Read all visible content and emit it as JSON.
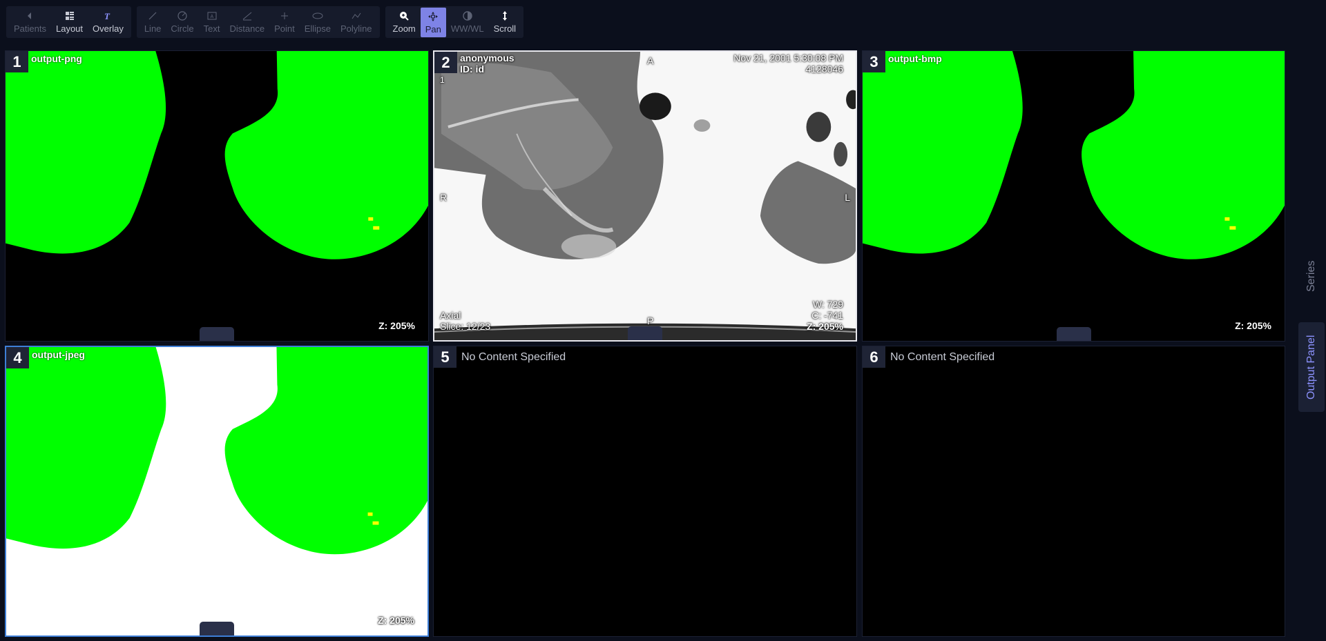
{
  "toolbar": {
    "group1": [
      {
        "label": "Patients",
        "icon": "back-arrow-icon",
        "disabled": true
      },
      {
        "label": "Layout",
        "icon": "layout-grid-icon",
        "disabled": false
      },
      {
        "label": "Overlay",
        "icon": "text-overlay-icon",
        "disabled": false
      }
    ],
    "group2": [
      {
        "label": "Line",
        "icon": "line-icon"
      },
      {
        "label": "Circle",
        "icon": "circle-icon"
      },
      {
        "label": "Text",
        "icon": "text-icon"
      },
      {
        "label": "Distance",
        "icon": "distance-icon"
      },
      {
        "label": "Point",
        "icon": "point-icon"
      },
      {
        "label": "Ellipse",
        "icon": "ellipse-icon"
      },
      {
        "label": "Polyline",
        "icon": "polyline-icon"
      }
    ],
    "group3": [
      {
        "label": "Zoom",
        "icon": "zoom-icon"
      },
      {
        "label": "Pan",
        "icon": "pan-icon",
        "active": true
      },
      {
        "label": "WW/WL",
        "icon": "window-level-icon",
        "disabled": true
      },
      {
        "label": "Scroll",
        "icon": "scroll-icon"
      }
    ]
  },
  "viewports": {
    "vp1": {
      "number": "1",
      "title": "output-png",
      "zoom": "Z: 205%"
    },
    "vp2": {
      "number": "2",
      "patient_name": "anonymous",
      "patient_id": "ID: id",
      "series_index": "1",
      "study_date": "Nov 21, 2001 5:30:08 PM",
      "study_number": "4128046",
      "orient_top": "A",
      "orient_bottom": "P",
      "orient_left": "R",
      "orient_right": "L",
      "plane": "Axial",
      "slice": "Slice: 12/23",
      "window_width": "W: 729",
      "window_center": "C: -741",
      "zoom": "Z: 205%"
    },
    "vp3": {
      "number": "3",
      "title": "output-bmp",
      "zoom": "Z: 205%"
    },
    "vp4": {
      "number": "4",
      "title": "output-jpeg",
      "zoom": "Z: 205%"
    },
    "vp5": {
      "number": "5",
      "title": "No Content Specified"
    },
    "vp6": {
      "number": "6",
      "title": "No Content Specified"
    }
  },
  "side_tabs": {
    "series": "Series",
    "output_panel": "Output Panel"
  },
  "colors": {
    "segmentation": "#00ff00",
    "lesion": "#ffff00",
    "accent": "#7e83e6",
    "background": "#0b0f1c"
  }
}
